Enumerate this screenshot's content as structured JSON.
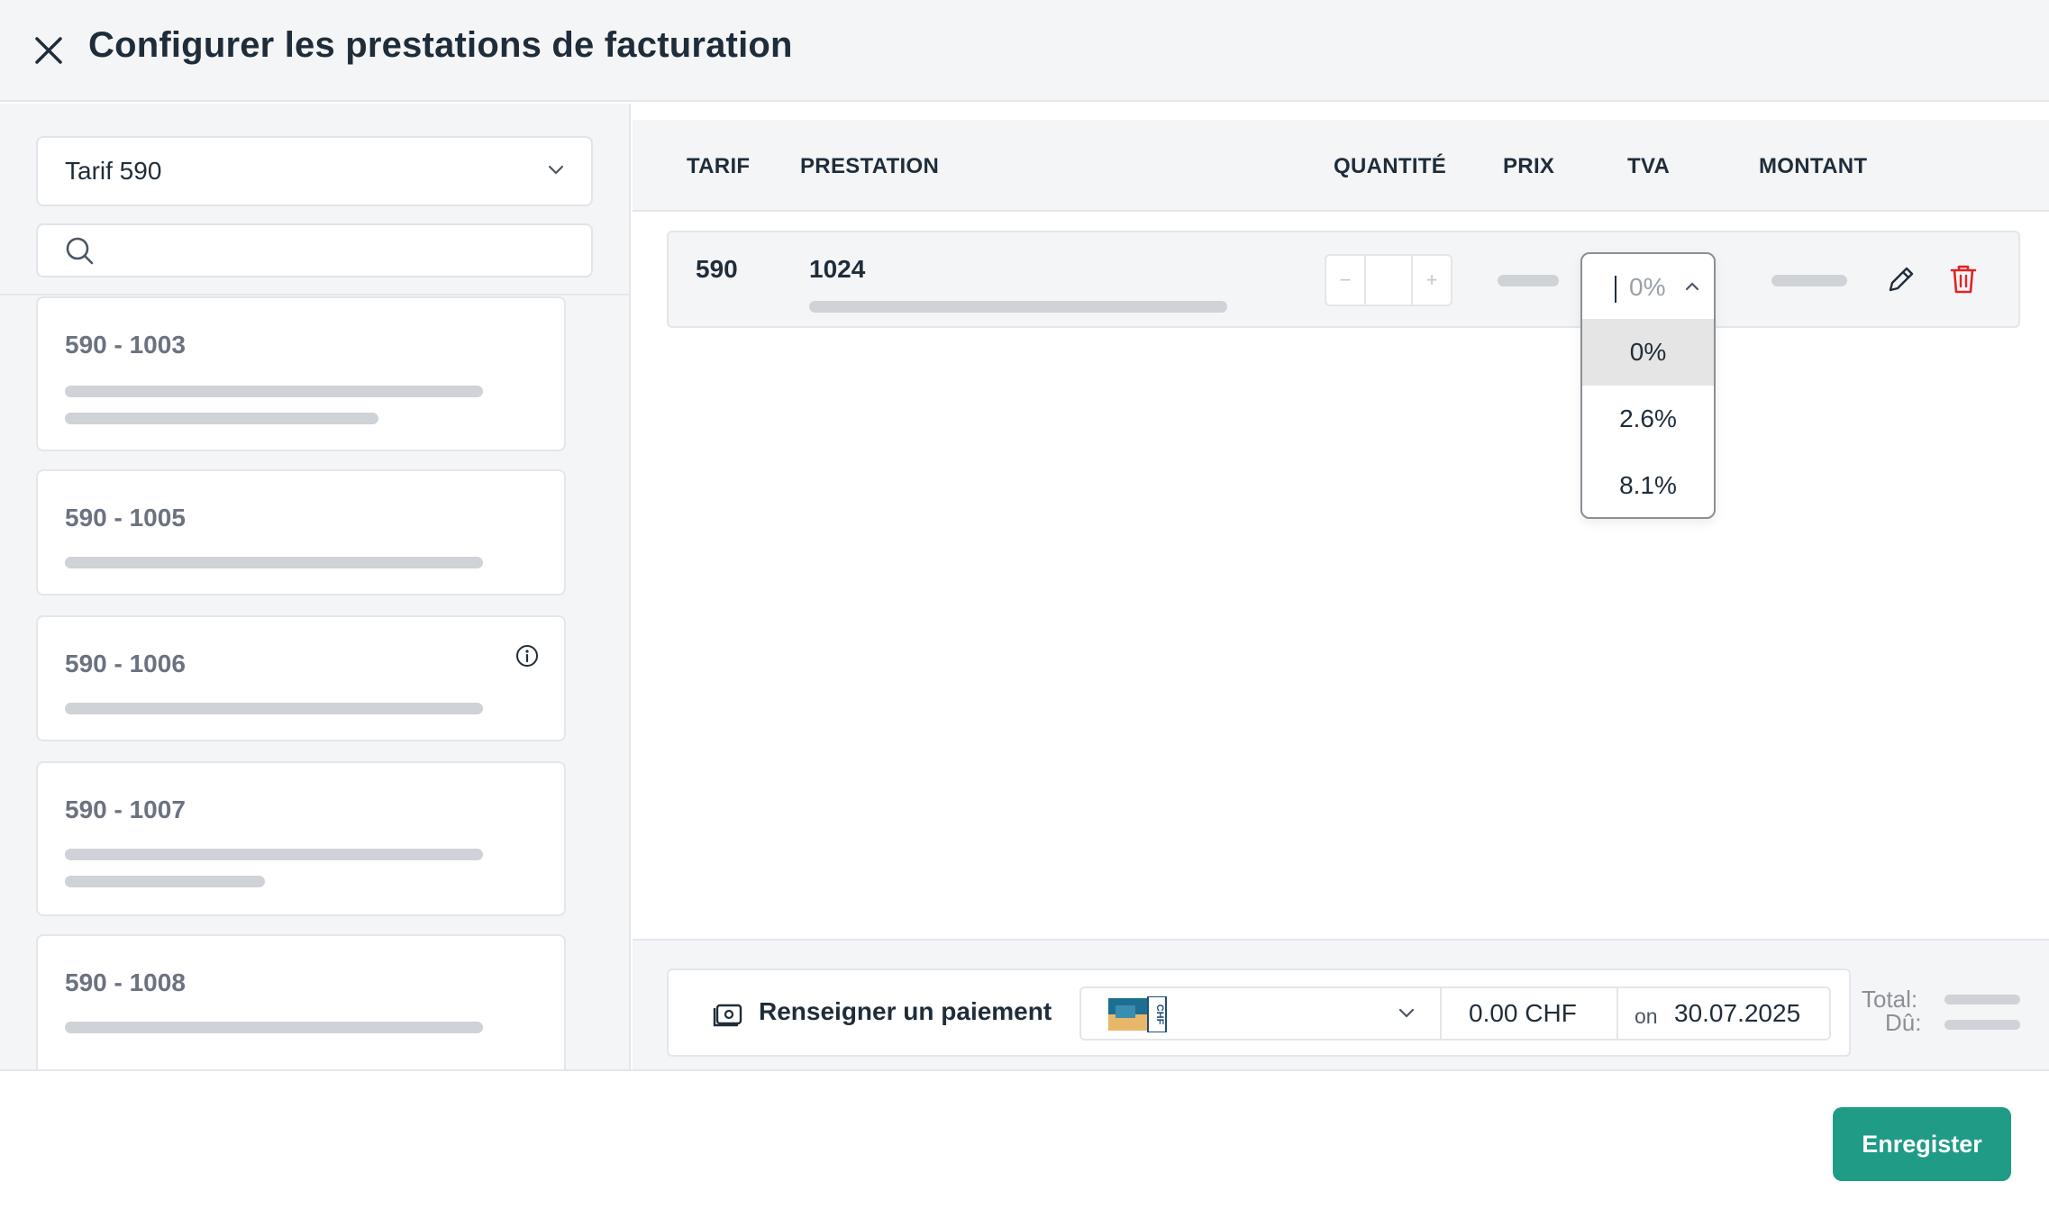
{
  "header": {
    "title": "Configurer les prestations de facturation"
  },
  "left": {
    "tarif_select": {
      "value": "Tarif 590"
    },
    "search": {
      "placeholder": ""
    },
    "cards": [
      {
        "code": "590 - 1003"
      },
      {
        "code": "590 - 1005"
      },
      {
        "code": "590 - 1006",
        "has_info": true
      },
      {
        "code": "590 - 1007"
      },
      {
        "code": "590 - 1008"
      }
    ]
  },
  "table": {
    "headers": {
      "tarif": "TARIF",
      "prestation": "PRESTATION",
      "quantite": "QUANTITÉ",
      "prix": "PRIX",
      "tva": "TVA",
      "montant": "MONTANT"
    },
    "rows": [
      {
        "tarif": "590",
        "prestation": "1024",
        "quantite": "",
        "stepper_minus": "−",
        "stepper_plus": "+"
      }
    ]
  },
  "tva_dropdown": {
    "current": "0%",
    "options": [
      "0%",
      "2.6%",
      "8.1%"
    ],
    "selected_index": 0
  },
  "payment": {
    "label": "Renseigner un paiement",
    "card_label": "CHF",
    "amount": "0.00 CHF",
    "date_prefix": "on",
    "date": "30.07.2025"
  },
  "totals": {
    "total_label": "Total:",
    "du_label": "Dû:"
  },
  "footer": {
    "save_label": "Enregister"
  },
  "colors": {
    "accent": "#1f9b86",
    "delete": "#e02424",
    "skeleton": "#cfd2d6",
    "panel_bg": "#f4f5f7"
  },
  "icons": [
    "close-icon",
    "chevron-down-icon",
    "search-icon",
    "info-icon",
    "pencil-icon",
    "trash-icon",
    "chevron-up-icon",
    "payment-icon",
    "card-icon"
  ]
}
